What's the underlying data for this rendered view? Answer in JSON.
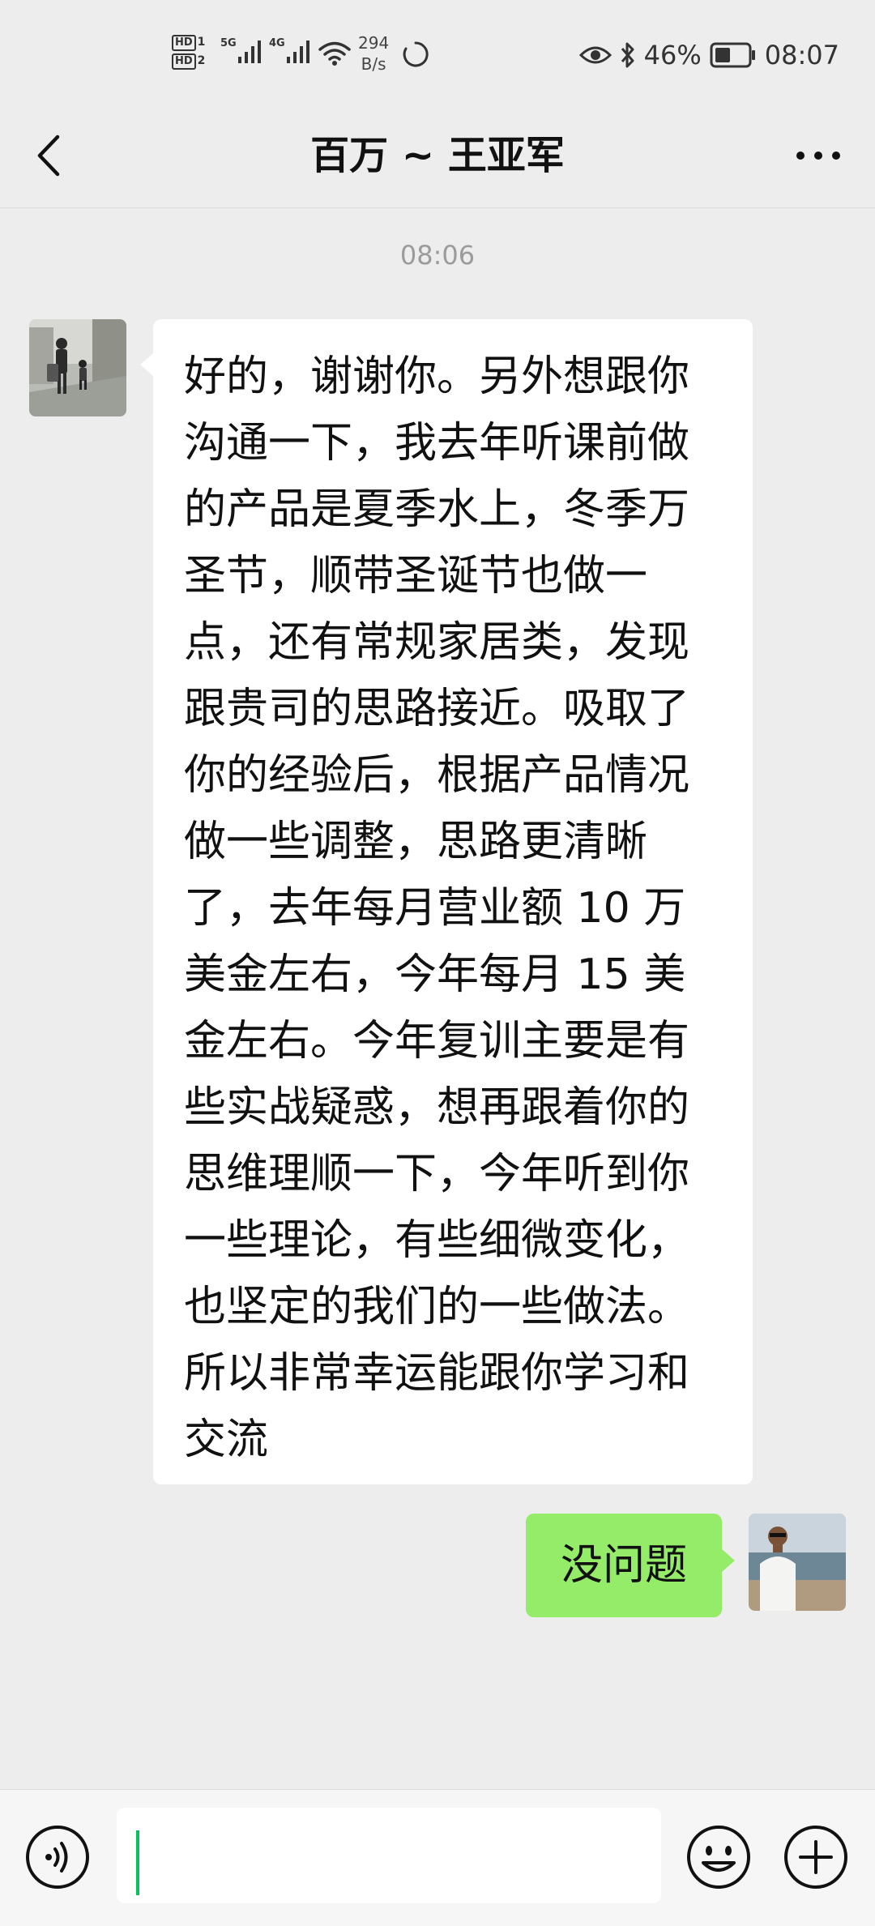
{
  "status_bar": {
    "hd1": "HD",
    "hd1_num": "1",
    "hd2": "HD",
    "hd2_num": "2",
    "net1": "5G",
    "net2": "4G",
    "speed_value": "294",
    "speed_unit": "B/s",
    "battery_percent": "46%",
    "time": "08:07"
  },
  "nav": {
    "title": "百万 ~ 王亚军",
    "icons": {
      "back": "chevron-left-icon",
      "more": "more-icon"
    }
  },
  "chat": {
    "timestamp": "08:06",
    "messages": [
      {
        "side": "incoming",
        "text": "好的，谢谢你。另外想跟你沟通一下，我去年听课前做的产品是夏季水上，冬季万圣节，顺带圣诞节也做一点，还有常规家居类，发现跟贵司的思路接近。吸取了你的经验后，根据产品情况做一些调整，思路更清晰了，去年每月营业额 10 万美金左右，今年每月 15 美金左右。今年复训主要是有些实战疑惑，想再跟着你的思维理顺一下，今年听到你一些理论，有些细微变化，也坚定的我们的一些做法。所以非常幸运能跟你学习和交流"
      },
      {
        "side": "outgoing",
        "text": "没问题"
      }
    ]
  },
  "input_bar": {
    "value": "",
    "icons": {
      "voice": "voice-icon",
      "emoji": "emoji-icon",
      "plus": "plus-icon"
    },
    "caret_color": "#07c160"
  },
  "colors": {
    "background": "#ededed",
    "incoming_bubble": "#ffffff",
    "outgoing_bubble": "#95ec69"
  }
}
